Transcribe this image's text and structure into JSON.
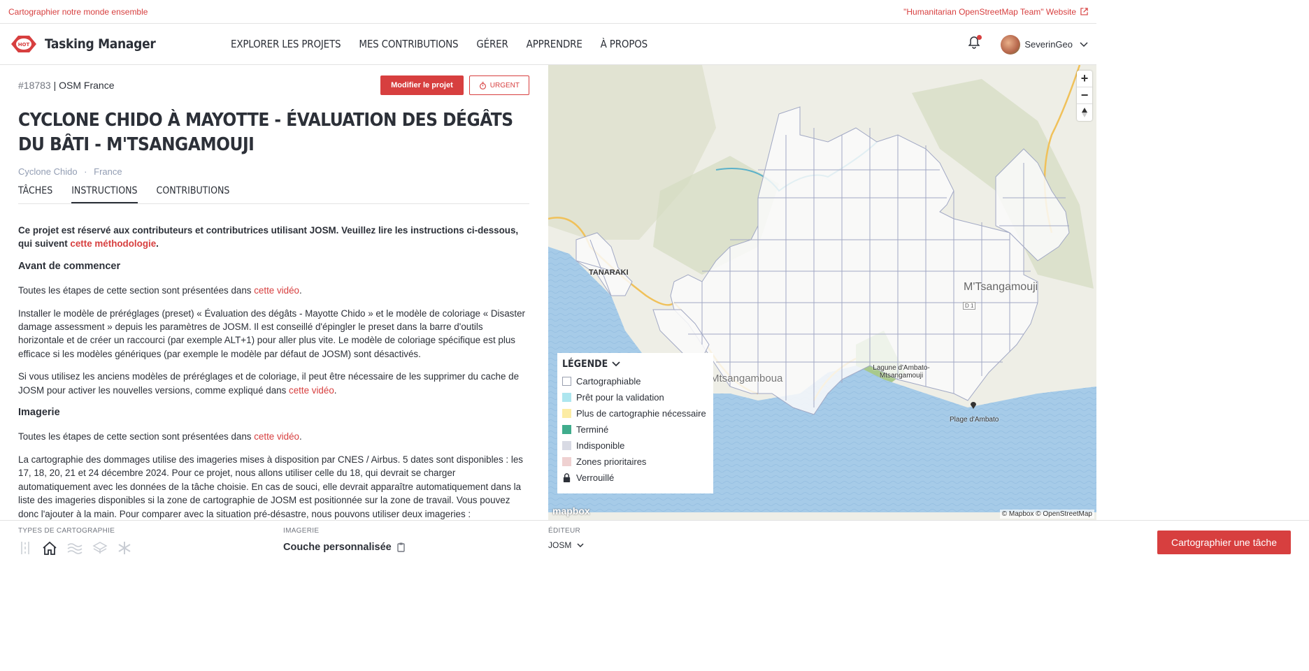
{
  "topbar": {
    "left_text": "Cartographier notre monde ensemble",
    "right_link": "\"Humanitarian OpenStreetMap Team\" Website"
  },
  "nav": {
    "logo_text": "Tasking Manager",
    "links": [
      "EXPLORER LES PROJETS",
      "MES CONTRIBUTIONS",
      "GÉRER",
      "APPRENDRE",
      "À PROPOS"
    ],
    "username": "SeverinGeo"
  },
  "project": {
    "id": "#18783",
    "org": "| OSM France",
    "edit_button": "Modifier le projet",
    "urgent_button": "URGENT",
    "title": "Cyclone Chido à Mayotte - Évaluation des dégâts du bâti - M'Tsangamouji",
    "tag1": "Cyclone Chido",
    "tag_sep": "·",
    "tag2": "France"
  },
  "tabs": [
    "TÂCHES",
    "INSTRUCTIONS",
    "CONTRIBUTIONS"
  ],
  "instructions": {
    "intro_text": "Ce projet est réservé aux contributeurs et contributrices utilisant JOSM. Veuillez lire les instructions ci-dessous, qui suivent ",
    "intro_link": "cette méthodologie",
    "intro_end": ".",
    "h_before": "Avant de commencer",
    "p1_text": "Toutes les étapes de cette section sont présentées dans ",
    "p1_link": "cette vidéo",
    "p1_end": ".",
    "p2": "Installer le modèle de préréglages (preset) « Évaluation des dégâts - Mayotte Chido » et le modèle de coloriage « Disaster damage assessment » depuis les paramètres de JOSM. Il est conseillé d'épingler le preset dans la barre d'outils horizontale et de créer un raccourci (par exemple ALT+1) pour aller plus vite. Le modèle de coloriage spécifique est plus efficace si les modèles génériques (par exemple le modèle par défaut de JOSM) sont désactivés.",
    "p3_text": "Si vous utilisez les anciens modèles de préréglages et de coloriage, il peut être nécessaire de les supprimer du cache de JOSM pour activer les nouvelles versions, comme expliqué dans ",
    "p3_link": "cette vidéo",
    "p3_end": ".",
    "h_imagery": "Imagerie",
    "p4_text": "Toutes les étapes de cette section sont présentées dans ",
    "p4_link": "cette vidéo",
    "p4_end": ".",
    "p5": "La cartographie des dommages utilise des imageries mises à disposition par CNES / Airbus. 5 dates sont disponibles : les 17, 18, 20, 21 et 24 décembre 2024. Pour ce projet, nous allons utiliser celle du 18, qui devrait se charger automatiquement avec les données de la tâche choisie. En cas de souci, elle devrait apparaître automatiquement dans la liste des imageries disponibles si la zone de cartographie de JOSM est positionnée sur la zone de travail. Vous pouvez donc l'ajouter à la main. Pour comparer avec la situation pré-désastre, nous pouvons utiliser deux imageries :"
  },
  "bottom": {
    "mapping_types_label": "TYPES DE CARTOGRAPHIE",
    "imagery_label": "IMAGERIE",
    "imagery_value": "Couche personnalisée",
    "editor_label": "ÉDITEUR",
    "editor_value": "JOSM",
    "map_task_button": "Cartographier une tâche"
  },
  "legend": {
    "title": "LÉGENDE",
    "items": [
      {
        "label": "Cartographiable",
        "color": "#ffffff"
      },
      {
        "label": "Prêt pour la validation",
        "color": "#ade6ef"
      },
      {
        "label": "Plus de cartographie nécessaire",
        "color": "#fceca4"
      },
      {
        "label": "Terminé",
        "color": "#40ac8c"
      },
      {
        "label": "Indisponible",
        "color": "#d8dae4"
      },
      {
        "label": "Zones prioritaires",
        "color": "#efd1d1"
      },
      {
        "label": "Verrouillé",
        "color": "lock"
      }
    ]
  },
  "map": {
    "attribution": "© Mapbox © OpenStreetMap",
    "mapbox_logo": "mapbox",
    "places": [
      "TANARAKI",
      "M'Tsangamouji",
      "Lagune d'Ambato-Mtsangamouji",
      "Plage d'Ambato",
      "Mtsangamboua",
      "D 1"
    ]
  },
  "colors": {
    "accent": "#d73f3f",
    "text": "#2c3038",
    "water": "#a6cbe8",
    "grid": "#a1a8c4"
  }
}
